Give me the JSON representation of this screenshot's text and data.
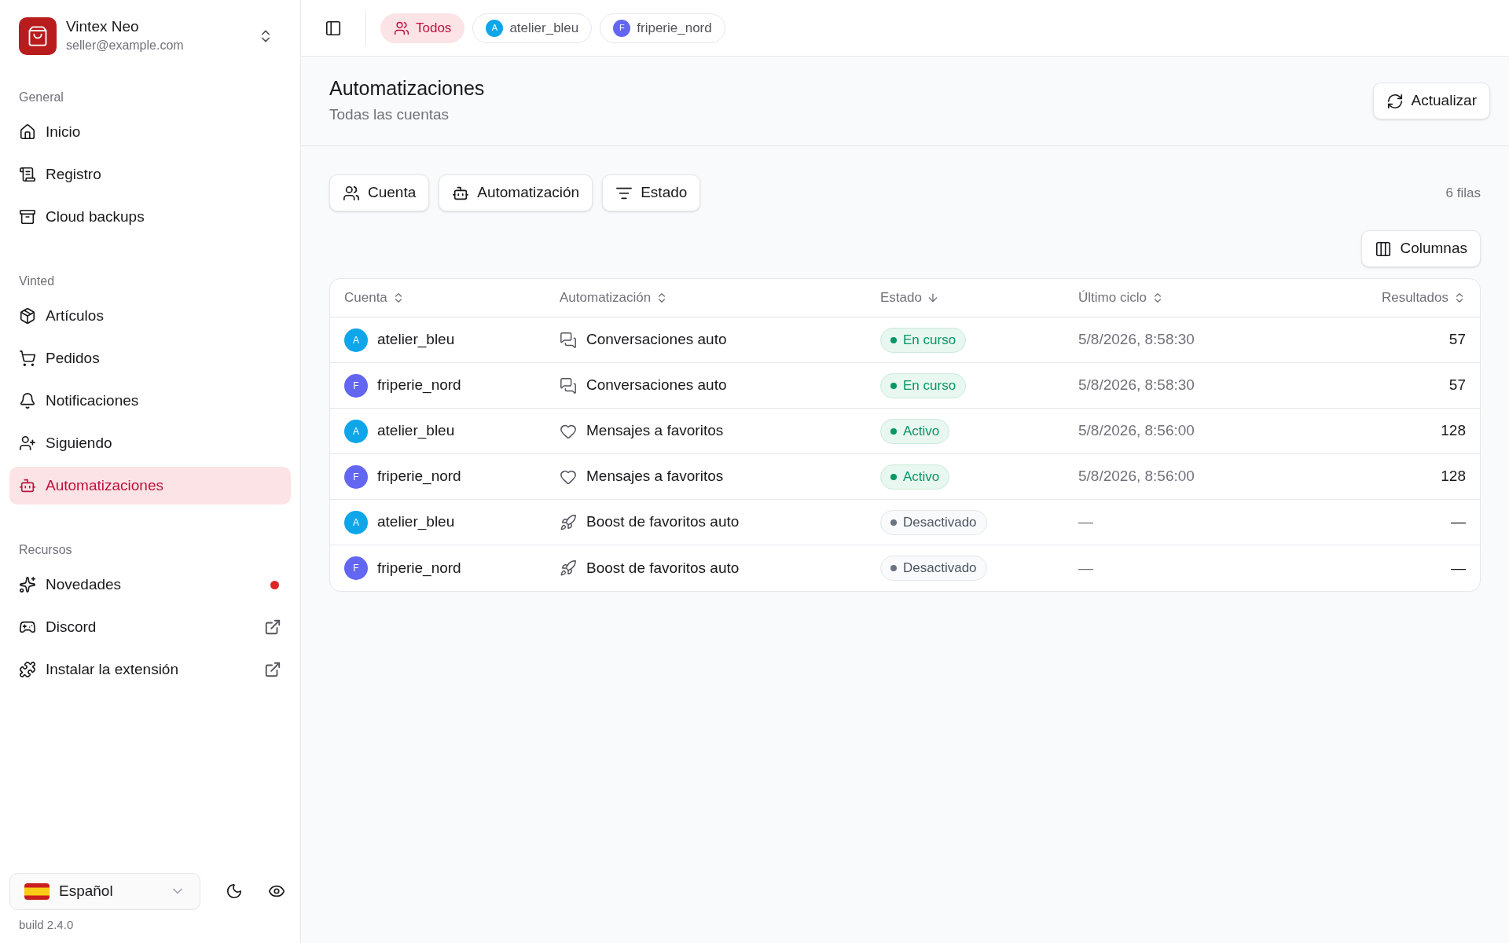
{
  "app": {
    "name": "Vintex Neo",
    "email": "seller@example.com"
  },
  "sidebar": {
    "sections": [
      {
        "title": "General",
        "items": [
          {
            "label": "Inicio",
            "selected": false
          },
          {
            "label": "Registro",
            "selected": false
          },
          {
            "label": "Cloud backups",
            "selected": false
          }
        ]
      },
      {
        "title": "Vinted",
        "items": [
          {
            "label": "Artículos",
            "selected": false
          },
          {
            "label": "Pedidos",
            "selected": false
          },
          {
            "label": "Notificaciones",
            "selected": false
          },
          {
            "label": "Siguiendo",
            "selected": false
          },
          {
            "label": "Automatizaciones",
            "selected": true
          }
        ]
      },
      {
        "title": "Recursos",
        "items": [
          {
            "label": "Novedades",
            "selected": false,
            "unread": true
          },
          {
            "label": "Discord",
            "selected": false,
            "external": true
          },
          {
            "label": "Instalar la extensión",
            "selected": false,
            "external": true
          }
        ]
      }
    ],
    "language": "Español",
    "build": "build 2.4.0"
  },
  "account_tabs": [
    {
      "label": "Todos",
      "selected": true
    },
    {
      "label": "atelier_bleu",
      "selected": false,
      "avatar": "A",
      "color": "#0ea5e9"
    },
    {
      "label": "friperie_nord",
      "selected": false,
      "avatar": "F",
      "color": "#6366f1"
    }
  ],
  "page": {
    "title": "Automatizaciones",
    "subtitle": "Todas las cuentas",
    "refresh_button": "Actualizar"
  },
  "filters": [
    "Cuenta",
    "Automatización",
    "Estado"
  ],
  "row_count": "6 filas",
  "columns_button": "Columnas",
  "table": {
    "columns": [
      {
        "label": "Cuenta",
        "sorted": false
      },
      {
        "label": "Automatización",
        "sorted": false
      },
      {
        "label": "Estado",
        "sorted": true
      },
      {
        "label": "Último ciclo",
        "sorted": false
      },
      {
        "label": "Resultados",
        "sorted": false
      }
    ],
    "rows": [
      {
        "account": "atelier_bleu",
        "avatar": "A",
        "color": "#0ea5e9",
        "kind": "chat",
        "automation": "Conversaciones auto",
        "status": "En curso",
        "enabled": true,
        "last_cycle": "5/8/2026, 8:58:30",
        "results": "57"
      },
      {
        "account": "friperie_nord",
        "avatar": "F",
        "color": "#6366f1",
        "kind": "chat",
        "automation": "Conversaciones auto",
        "status": "En curso",
        "enabled": true,
        "last_cycle": "5/8/2026, 8:58:30",
        "results": "57"
      },
      {
        "account": "atelier_bleu",
        "avatar": "A",
        "color": "#0ea5e9",
        "kind": "heart",
        "automation": "Mensajes a favoritos",
        "status": "Activo",
        "enabled": true,
        "last_cycle": "5/8/2026, 8:56:00",
        "results": "128"
      },
      {
        "account": "friperie_nord",
        "avatar": "F",
        "color": "#6366f1",
        "kind": "heart",
        "automation": "Mensajes a favoritos",
        "status": "Activo",
        "enabled": true,
        "last_cycle": "5/8/2026, 8:56:00",
        "results": "128"
      },
      {
        "account": "atelier_bleu",
        "avatar": "A",
        "color": "#0ea5e9",
        "kind": "rocket",
        "automation": "Boost de favoritos auto",
        "status": "Desactivado",
        "enabled": false,
        "last_cycle": "—",
        "results": "—"
      },
      {
        "account": "friperie_nord",
        "avatar": "F",
        "color": "#6366f1",
        "kind": "rocket",
        "automation": "Boost de favoritos auto",
        "status": "Desactivado",
        "enabled": false,
        "last_cycle": "—",
        "results": "—"
      }
    ]
  }
}
